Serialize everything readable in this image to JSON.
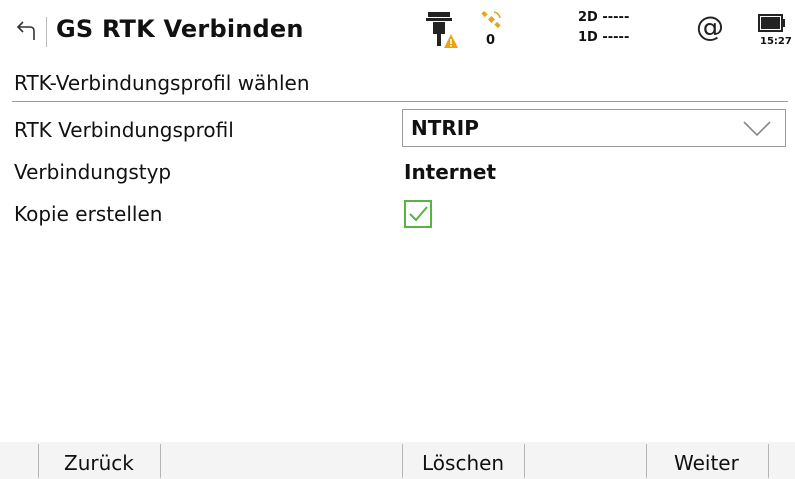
{
  "header": {
    "title": "GS RTK Verbinden",
    "satellite_count": "0",
    "quality_2d": "2D -----",
    "quality_1d": "1D -----",
    "at_symbol": "@",
    "clock": "15:27",
    "icons": [
      "back-arrow-icon",
      "rover-warning-icon",
      "satellite-icon",
      "internet-at-icon",
      "battery-icon"
    ],
    "warning_color": "#e8a317",
    "satellite_color": "#e8a317"
  },
  "section": {
    "title": "RTK-Verbindungsprofil wählen"
  },
  "form": {
    "profile_label": "RTK Verbindungsprofil",
    "profile_value": "NTRIP",
    "connection_type_label": "Verbindungstyp",
    "connection_type_value": "Internet",
    "copy_label": "Kopie erstellen",
    "copy_checked": true,
    "checkbox_color": "#57b342"
  },
  "softkeys": {
    "back": "Zurück",
    "delete": "Löschen",
    "next": "Weiter"
  }
}
